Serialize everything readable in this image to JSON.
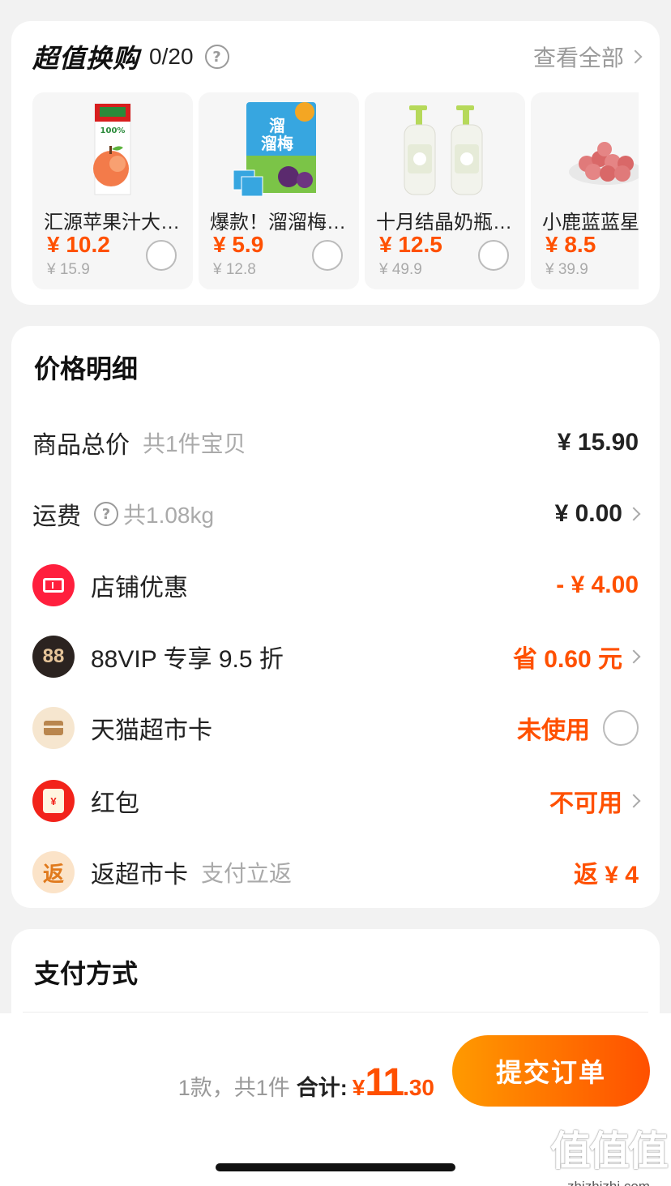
{
  "exchange": {
    "title": "超值换购",
    "count": "0/20",
    "help_glyph": "?",
    "view_all": "查看全部",
    "products": [
      {
        "name": "汇源苹果汁大…",
        "price": "¥ 10.2",
        "original": "¥ 15.9",
        "icon": "juice-carton-icon"
      },
      {
        "name": "爆款！溜溜梅…",
        "price": "¥ 5.9",
        "original": "¥ 12.8",
        "icon": "plum-snack-icon"
      },
      {
        "name": "十月结晶奶瓶…",
        "price": "¥ 12.5",
        "original": "¥ 49.9",
        "icon": "foam-bottle-icon"
      },
      {
        "name": "小鹿蓝蓝星",
        "price": "¥ 8.5",
        "original": "¥ 39.9",
        "icon": "peanut-snack-icon"
      }
    ]
  },
  "detail": {
    "title": "价格明细",
    "total": {
      "label": "商品总价",
      "sub": "共1件宝贝",
      "value": "¥ 15.90"
    },
    "shipping": {
      "label": "运费",
      "help_glyph": "?",
      "sub": "共1.08kg",
      "value": "¥ 0.00"
    },
    "shop_discount": {
      "label": "店铺优惠",
      "value": "- ¥ 4.00"
    },
    "vip": {
      "badge": "88",
      "label": "88VIP 专享 9.5 折",
      "value": "省 0.60 元"
    },
    "tmall_card": {
      "label": "天猫超市卡",
      "value": "未使用"
    },
    "red_packet": {
      "badge": "¥",
      "label": "红包",
      "value": "不可用"
    },
    "cashback": {
      "badge": "返",
      "label": "返超市卡",
      "sub": "支付立返",
      "value": "返 ¥ 4"
    }
  },
  "payment": {
    "title": "支付方式"
  },
  "bottom": {
    "count_text": "1款，共1件",
    "total_label": "合计:",
    "currency": "¥",
    "total_int": "11",
    "total_dec": ".30",
    "submit": "提交订单"
  },
  "watermark": {
    "logo": "值值值",
    "url": "zhizhizhi.com"
  },
  "colors": {
    "accent": "#ff5000",
    "background": "#f2f2f2",
    "muted": "#aaaaaa"
  }
}
